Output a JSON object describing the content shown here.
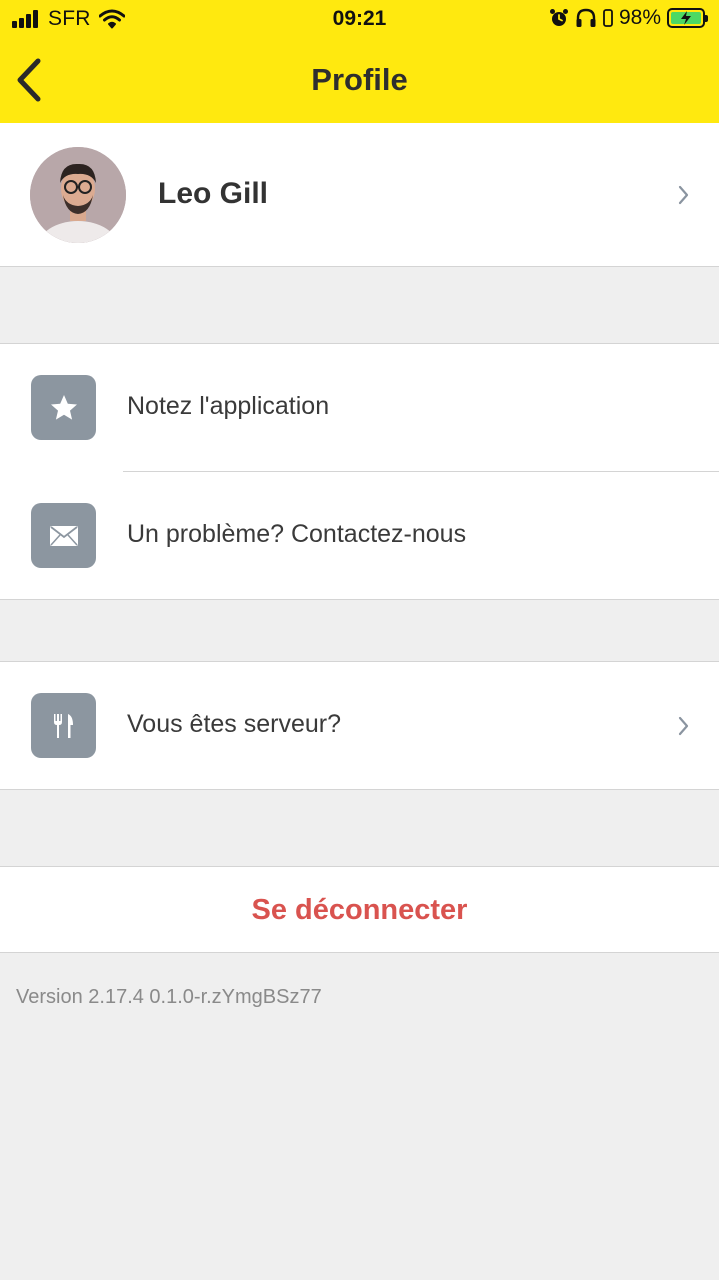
{
  "status_bar": {
    "carrier": "SFR",
    "time": "09:21",
    "battery": "98%"
  },
  "nav": {
    "title": "Profile"
  },
  "profile": {
    "name": "Leo Gill"
  },
  "menu": {
    "rate_app": "Notez l'application",
    "contact": "Un problème? Contactez-nous",
    "server": "Vous êtes serveur?"
  },
  "logout": {
    "label": "Se déconnecter"
  },
  "footer": {
    "version": "Version 2.17.4 0.1.0-r.zYmgBSz77"
  },
  "colors": {
    "header_bg": "#ffe90f",
    "icon_tile": "#8c96a0",
    "logout_text": "#d9534f",
    "page_bg": "#efefef"
  },
  "icons": [
    "chevron-left-icon",
    "star-icon",
    "mail-icon",
    "cutlery-icon",
    "chevron-right-icon",
    "alarm-icon",
    "headphones-icon",
    "battery-icon"
  ]
}
